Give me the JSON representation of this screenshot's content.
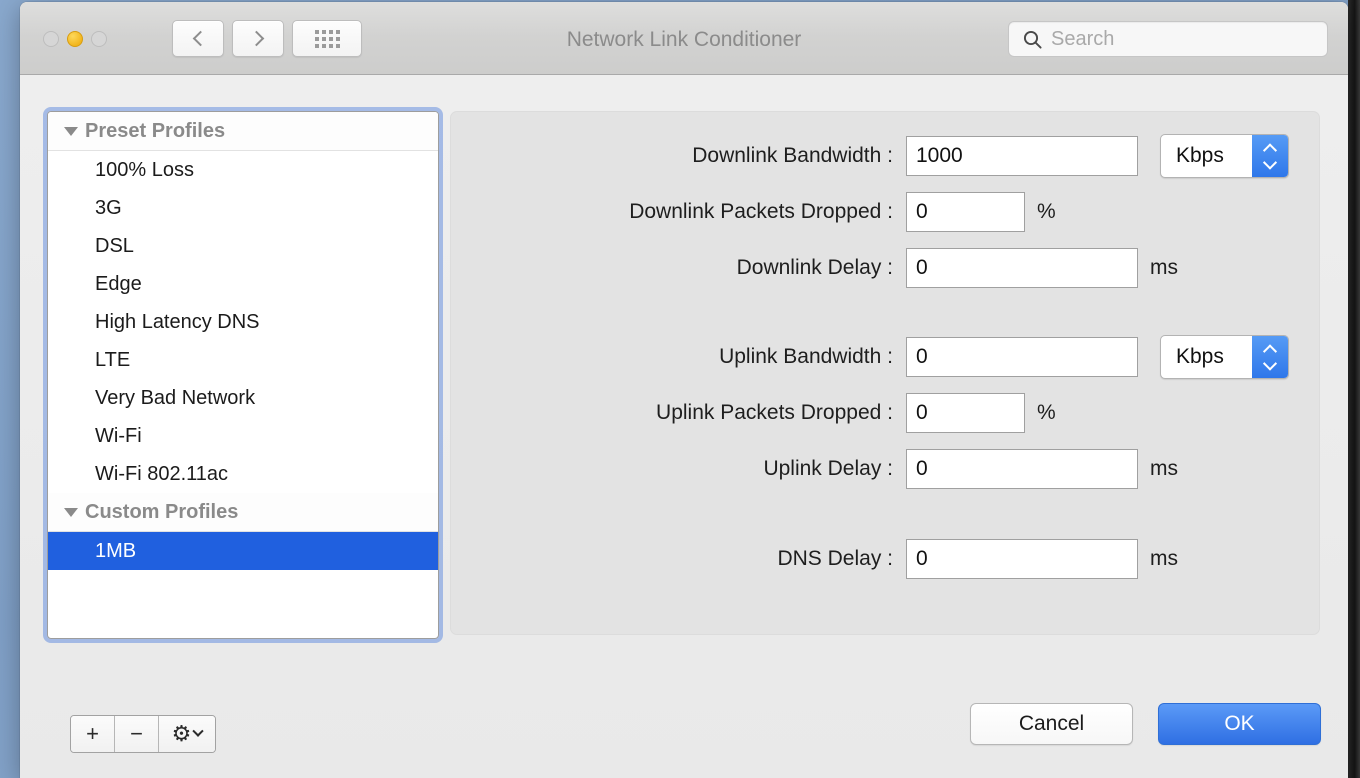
{
  "window": {
    "title": "Network Link Conditioner",
    "traffic_lights": [
      "close-inactive",
      "minimize-yellow",
      "zoom-inactive"
    ]
  },
  "toolbar": {
    "back_icon": "chevron-left-icon",
    "forward_icon": "chevron-right-icon",
    "grid_icon": "show-all-grid-icon",
    "search": {
      "icon": "search-icon",
      "value": "",
      "placeholder": "Search"
    }
  },
  "profiles": {
    "groups": [
      {
        "label": "Preset Profiles",
        "disclosure": "triangle-down-icon",
        "items": [
          {
            "label": "100% Loss",
            "selected": false
          },
          {
            "label": "3G",
            "selected": false
          },
          {
            "label": "DSL",
            "selected": false
          },
          {
            "label": "Edge",
            "selected": false
          },
          {
            "label": "High Latency DNS",
            "selected": false
          },
          {
            "label": "LTE",
            "selected": false
          },
          {
            "label": "Very Bad Network",
            "selected": false
          },
          {
            "label": "Wi-Fi",
            "selected": false
          },
          {
            "label": "Wi-Fi 802.11ac",
            "selected": false
          }
        ]
      },
      {
        "label": "Custom Profiles",
        "disclosure": "triangle-down-icon",
        "items": [
          {
            "label": "1MB",
            "selected": true
          }
        ]
      }
    ],
    "buttons": [
      {
        "name": "add-profile-button",
        "glyph": "+"
      },
      {
        "name": "remove-profile-button",
        "glyph": "−"
      },
      {
        "name": "actions-gear-button",
        "glyph": "⚙"
      }
    ]
  },
  "settings": {
    "rows": [
      {
        "label": "Downlink Bandwidth :",
        "value": "1000",
        "unit_popup": "Kbps",
        "suffix": ""
      },
      {
        "label": "Downlink Packets Dropped :",
        "value": "0",
        "unit_popup": null,
        "suffix": "%"
      },
      {
        "label": "Downlink Delay :",
        "value": "0",
        "unit_popup": null,
        "suffix": "ms"
      },
      {
        "label": "Uplink Bandwidth :",
        "value": "0",
        "unit_popup": "Kbps",
        "suffix": ""
      },
      {
        "label": "Uplink Packets Dropped :",
        "value": "0",
        "unit_popup": null,
        "suffix": "%"
      },
      {
        "label": "Uplink Delay :",
        "value": "0",
        "unit_popup": null,
        "suffix": "ms"
      },
      {
        "label": "DNS Delay :",
        "value": "0",
        "unit_popup": null,
        "suffix": "ms"
      }
    ]
  },
  "footer": {
    "cancel_label": "Cancel",
    "ok_label": "OK"
  },
  "colors": {
    "selection_blue": "#2060df",
    "default_button_blue": "#2f6fe3",
    "popup_arrow_blue": "#2f77ea",
    "focus_ring": "#7b9be1",
    "minimize_yellow": "#f2b51c"
  }
}
